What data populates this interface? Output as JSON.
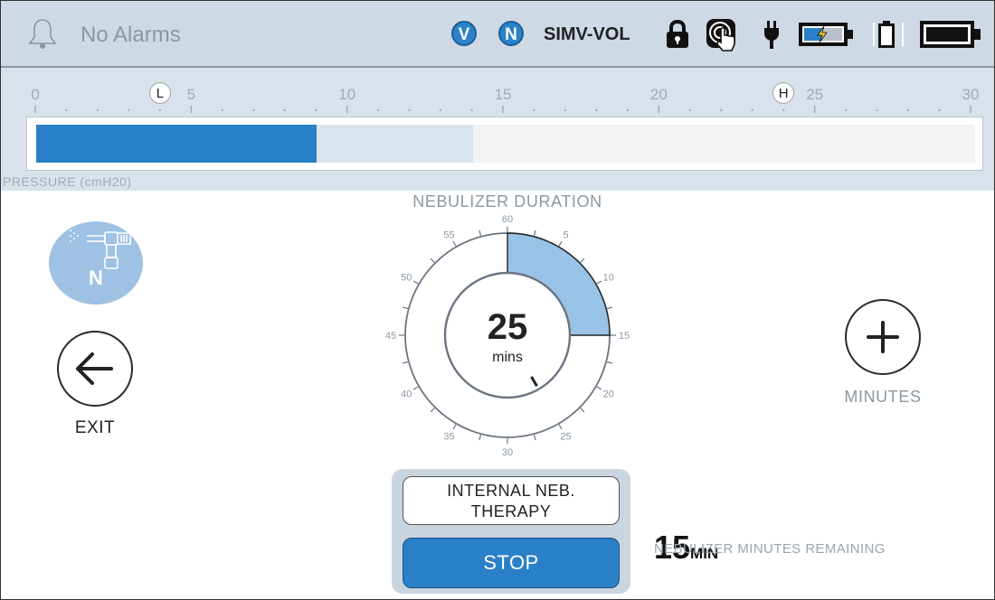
{
  "header": {
    "alarm_text": "No Alarms",
    "badge_v": "V",
    "badge_n": "N",
    "mode": "SIMV-VOL",
    "icons": [
      "bell-icon",
      "lock-icon",
      "touch-icon",
      "ac-plug-icon",
      "battery-charging-icon",
      "battery-small-icon",
      "battery-full-icon"
    ]
  },
  "pressure_scale": {
    "ticks": [
      "0",
      "5",
      "10",
      "15",
      "20",
      "25",
      "30"
    ],
    "low_marker": "L",
    "high_marker": "H",
    "low_value": 4,
    "high_value": 24,
    "current_value": 9,
    "target_value": 14,
    "label": "PRESSURE (cmH20)",
    "fill_color": "#2a80c6"
  },
  "nebulizer": {
    "icon_letter": "N",
    "duration_title": "NEBULIZER DURATION",
    "dial_ticks": [
      "60",
      "5",
      "10",
      "15",
      "20",
      "25",
      "30",
      "35",
      "40",
      "45",
      "50",
      "55"
    ],
    "dial_value": "25",
    "dial_unit": "mins",
    "dial_fill_minutes": 15,
    "minutes_label": "MINUTES",
    "exit_label": "EXIT",
    "therapy_line1": "INTERNAL NEB.",
    "therapy_line2": "THERAPY",
    "stop_label": "STOP",
    "remaining_value": "15",
    "remaining_unit": "MIN",
    "remaining_label": "NEBULIZER MINUTES REMAINING"
  }
}
